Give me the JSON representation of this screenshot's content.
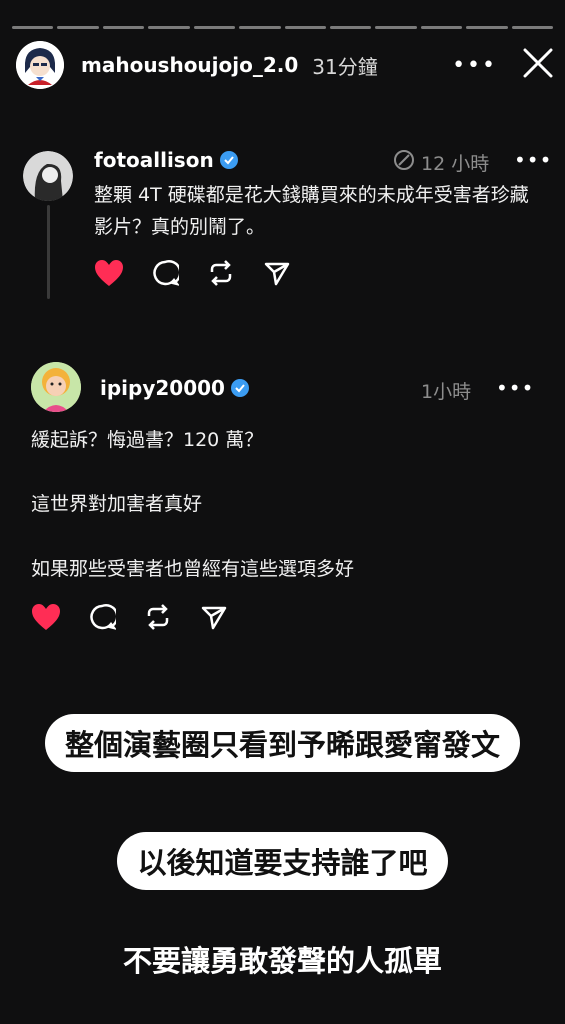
{
  "story": {
    "segments": 12,
    "username": "mahoushoujojo_2.0",
    "time": "31分鐘",
    "more_label": "•••",
    "close_label": "×"
  },
  "post1": {
    "username": "fotoallison",
    "time": "12 小時",
    "more_label": "•••",
    "text": "整顆 4T 硬碟都是花大錢購買來的未成年受害者珍藏影片？真的別鬧了。"
  },
  "post2": {
    "username": "ipipy20000",
    "time": "1小時",
    "more_label": "•••",
    "line1": "緩起訴？悔過書？120 萬？",
    "line2": "這世界對加害者真好",
    "line3": "如果那些受害者也曾經有這些選項多好"
  },
  "captions": {
    "c1": "整個演藝圈只看到予晞跟愛甯發文",
    "c2": "以後知道要支持誰了吧",
    "c3": "不要讓勇敢發聲的人孤單"
  },
  "colors": {
    "heart": "#ff2d55",
    "verified": "#3b9cf2",
    "background": "#0f0f10"
  },
  "icons": [
    "heart-icon",
    "comment-icon",
    "repost-icon",
    "share-icon",
    "verified-icon",
    "close-icon",
    "more-icon"
  ]
}
